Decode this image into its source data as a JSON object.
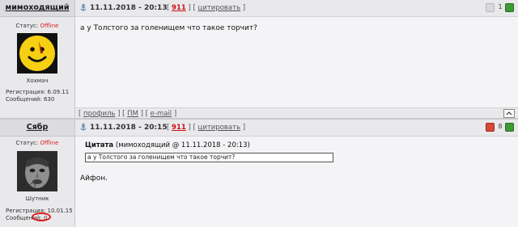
{
  "posts": [
    {
      "author": "мимоходящий",
      "status_label": "Статус:",
      "status_value": "Offline",
      "rank": "Хохмач",
      "reg_label": "Регистрация:",
      "reg_date": "6.09.11",
      "msgs_label": "Сообщений:",
      "msgs_count": "630",
      "datetime": "11.11.2018 - 20:13",
      "post_number": "911",
      "quote_link": "цитировать",
      "vote_count": "1",
      "text": "а у Толстого за голенищем что такое торчит?",
      "footer_links": [
        "профиль",
        "ПМ",
        "e-mail"
      ]
    },
    {
      "author": "Сябр",
      "status_label": "Статус:",
      "status_value": "Offline",
      "rank": "Шутник",
      "reg_label": "Регистрация:",
      "reg_date": "10.01.15",
      "msgs_label": "Сообщений:",
      "msgs_count": "0",
      "datetime": "11.11.2018 - 20:15",
      "post_number": "911",
      "quote_link": "цитировать",
      "vote_count": "8",
      "quote_heading": "Цитата",
      "quote_source": "(мимоходящий @ 11.11.2018 - 20:13)",
      "quote_text": "а у Толстого за голенищем что такое торчит?",
      "text": "Айфон."
    }
  ],
  "colors": {
    "accent_red": "#cc1111",
    "annotation_red": "#e31b1b",
    "offline": "#e02020",
    "vote_up": "#3e9a34",
    "vote_down": "#d44a3c"
  },
  "icons": [
    "anchor-icon",
    "vote-down-icon",
    "vote-up-icon",
    "scroll-top-icon"
  ]
}
